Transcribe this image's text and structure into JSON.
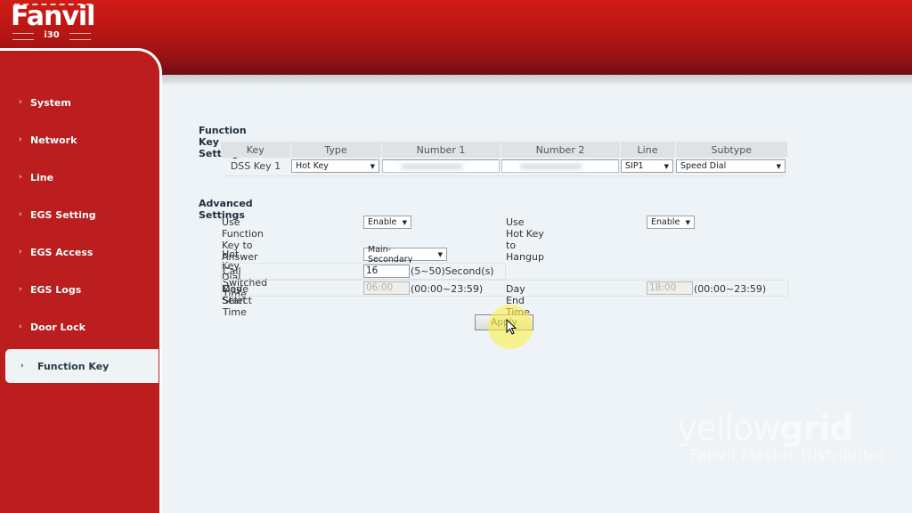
{
  "brand": {
    "logo_text": "Fanvil",
    "model": "i30"
  },
  "sidebar": {
    "items": [
      {
        "label": "System",
        "active": false
      },
      {
        "label": "Network",
        "active": false
      },
      {
        "label": "Line",
        "active": false
      },
      {
        "label": "EGS Setting",
        "active": false
      },
      {
        "label": "EGS Access",
        "active": false
      },
      {
        "label": "EGS Logs",
        "active": false
      },
      {
        "label": "Door Lock",
        "active": false
      },
      {
        "label": "Function Key",
        "active": true
      }
    ],
    "chevron": "›"
  },
  "function_key_settings": {
    "title": "Function Key Settings",
    "columns": [
      "Key",
      "Type",
      "Number 1",
      "Number 2",
      "Line",
      "Subtype"
    ],
    "rows": [
      {
        "key": "DSS Key 1",
        "type": "Hot Key",
        "number1": "",
        "number2": "",
        "line": "SIP1",
        "subtype": "Speed Dial"
      }
    ]
  },
  "advanced_settings": {
    "title": "Advanced Settings",
    "use_function_key_to_answer": {
      "label": "Use Function Key to Answer",
      "value": "Enable"
    },
    "use_hot_key_to_hangup": {
      "label": "Use Hot Key to Hangup",
      "value": "Enable"
    },
    "hot_key_dial_mode": {
      "label": "Hot Key Dial Mode Select",
      "value": "Main-Secondary"
    },
    "call_switched_time": {
      "label": "Call Switched Time",
      "value": "16",
      "hint": "(5~50)Second(s)"
    },
    "day_start_time": {
      "label": "Day Start Time",
      "value": "06:00",
      "hint": "(00:00~23:59)"
    },
    "day_end_time": {
      "label": "Day End Time",
      "value": "18:00",
      "hint": "(00:00~23:59)"
    }
  },
  "apply_label": "Apply",
  "watermark": {
    "main_light": "yellow",
    "main_bold": "grid",
    "sub": "Fanvil Master Distributor"
  },
  "colors": {
    "header_red": "#c41a16",
    "sidebar_red": "#bc1e1f",
    "content_bg": "#edf3f6"
  }
}
